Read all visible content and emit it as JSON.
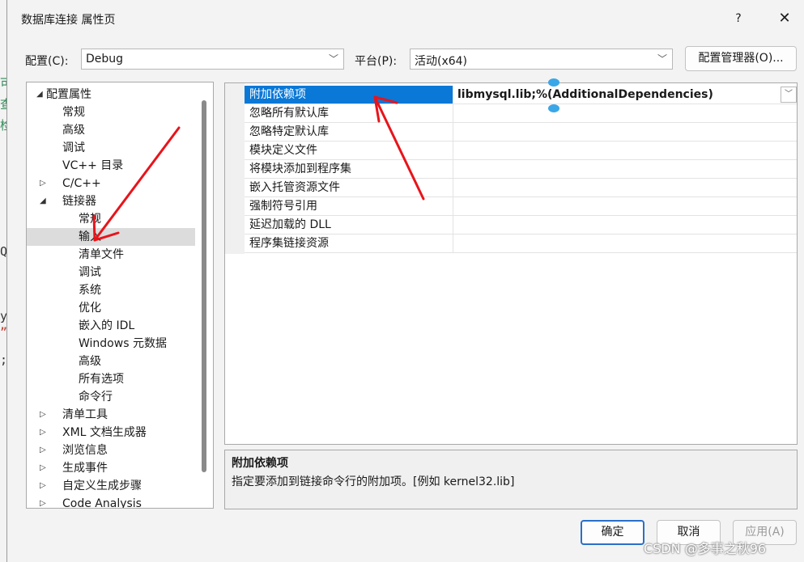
{
  "background_fragments": [
    "可",
    "查",
    "检",
    "QI",
    "ys",
    "”,",
    ";"
  ],
  "dialog": {
    "title": "数据库连接 属性页",
    "help_label": "?",
    "close_label": "✕"
  },
  "config": {
    "label": "配置(C):",
    "value": "Debug",
    "platform_label": "平台(P):",
    "platform_value": "活动(x64)",
    "manager_button": "配置管理器(O)..."
  },
  "tree": {
    "items": [
      {
        "label": "配置属性",
        "level": 0,
        "expander": "◢"
      },
      {
        "label": "常规",
        "level": 1,
        "expander": ""
      },
      {
        "label": "高级",
        "level": 1,
        "expander": ""
      },
      {
        "label": "调试",
        "level": 1,
        "expander": ""
      },
      {
        "label": "VC++ 目录",
        "level": 1,
        "expander": ""
      },
      {
        "label": "C/C++",
        "level": 1,
        "expander": "▷"
      },
      {
        "label": "链接器",
        "level": 1,
        "expander": "◢"
      },
      {
        "label": "常规",
        "level": 2,
        "expander": ""
      },
      {
        "label": "输入",
        "level": 2,
        "expander": "",
        "selected": true
      },
      {
        "label": "清单文件",
        "level": 2,
        "expander": ""
      },
      {
        "label": "调试",
        "level": 2,
        "expander": ""
      },
      {
        "label": "系统",
        "level": 2,
        "expander": ""
      },
      {
        "label": "优化",
        "level": 2,
        "expander": ""
      },
      {
        "label": "嵌入的 IDL",
        "level": 2,
        "expander": ""
      },
      {
        "label": "Windows 元数据",
        "level": 2,
        "expander": ""
      },
      {
        "label": "高级",
        "level": 2,
        "expander": ""
      },
      {
        "label": "所有选项",
        "level": 2,
        "expander": ""
      },
      {
        "label": "命令行",
        "level": 2,
        "expander": ""
      },
      {
        "label": "清单工具",
        "level": 1,
        "expander": "▷"
      },
      {
        "label": "XML 文档生成器",
        "level": 1,
        "expander": "▷"
      },
      {
        "label": "浏览信息",
        "level": 1,
        "expander": "▷"
      },
      {
        "label": "生成事件",
        "level": 1,
        "expander": "▷"
      },
      {
        "label": "自定义生成步骤",
        "level": 1,
        "expander": "▷"
      },
      {
        "label": "Code Analysis",
        "level": 1,
        "expander": "▷"
      }
    ]
  },
  "grid": {
    "rows": [
      {
        "name": "附加依赖项",
        "value": "libmysql.lib;%(AdditionalDependencies)",
        "selected": true
      },
      {
        "name": "忽略所有默认库",
        "value": ""
      },
      {
        "name": "忽略特定默认库",
        "value": ""
      },
      {
        "name": "模块定义文件",
        "value": ""
      },
      {
        "name": "将模块添加到程序集",
        "value": ""
      },
      {
        "name": "嵌入托管资源文件",
        "value": ""
      },
      {
        "name": "强制符号引用",
        "value": ""
      },
      {
        "name": "延迟加载的 DLL",
        "value": ""
      },
      {
        "name": "程序集链接资源",
        "value": ""
      }
    ]
  },
  "description": {
    "title": "附加依赖项",
    "text": "指定要添加到链接命令行的附加项。[例如 kernel32.lib]"
  },
  "buttons": {
    "ok": "确定",
    "cancel": "取消",
    "apply": "应用(A)"
  },
  "watermark": "CSDN @多事之秋96",
  "colors": {
    "selection": "#0a78d7",
    "annotation_arrow": "#e8141b"
  }
}
